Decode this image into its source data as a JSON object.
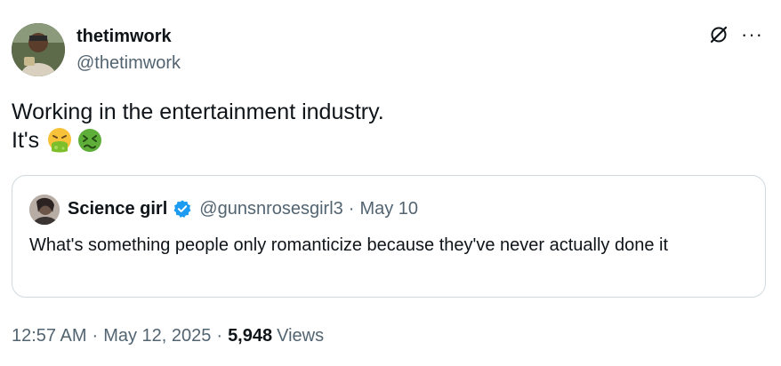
{
  "author": {
    "name": "thetimwork",
    "handle": "@thetimwork"
  },
  "tweet": {
    "line1": "Working in the entertainment industry.",
    "line2": "It's",
    "emojis": [
      "face-vomiting-emoji",
      "nauseated-face-emoji"
    ]
  },
  "quoted": {
    "name": "Science girl",
    "handle": "@gunsnrosesgirl3",
    "separator": "·",
    "date": "May 10",
    "text": "What's something people only romanticize because they've never actually done it"
  },
  "meta": {
    "time": "12:57 AM",
    "separator1": "·",
    "date": "May 12, 2025",
    "separator2": "·",
    "views_count": "5,948",
    "views_label": "Views"
  },
  "icons": {
    "grok": "grok-icon",
    "more": "more-icon",
    "verified": "verified-badge-icon"
  },
  "colors": {
    "text": "#0f1419",
    "secondary": "#536471",
    "verified": "#1d9bf0",
    "border": "#cfd9de"
  }
}
